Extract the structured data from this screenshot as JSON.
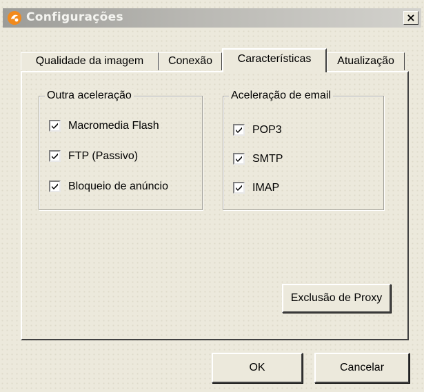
{
  "window": {
    "title": "Configurações",
    "close_label": "×"
  },
  "tabs": [
    {
      "label": "Qualidade da imagem",
      "active": false
    },
    {
      "label": "Conexão",
      "active": false
    },
    {
      "label": "Características",
      "active": true
    },
    {
      "label": "Atualização",
      "active": false
    }
  ],
  "groups": {
    "other_acceleration": {
      "legend": "Outra aceleração",
      "items": [
        {
          "label": "Macromedia Flash",
          "checked": true
        },
        {
          "label": "FTP (Passivo)",
          "checked": true
        },
        {
          "label": "Bloqueio de anúncio",
          "checked": true
        }
      ]
    },
    "email_acceleration": {
      "legend": "Aceleração de email",
      "items": [
        {
          "label": "POP3",
          "checked": true
        },
        {
          "label": "SMTP",
          "checked": true
        },
        {
          "label": "IMAP",
          "checked": true
        }
      ]
    }
  },
  "buttons": {
    "proxy_exclusion": "Exclusão de Proxy",
    "ok": "OK",
    "cancel": "Cancelar"
  },
  "colors": {
    "title_gradient_start": "#9c9c98",
    "title_gradient_end": "#d3d2cd",
    "app_icon": "#f28a1c"
  }
}
